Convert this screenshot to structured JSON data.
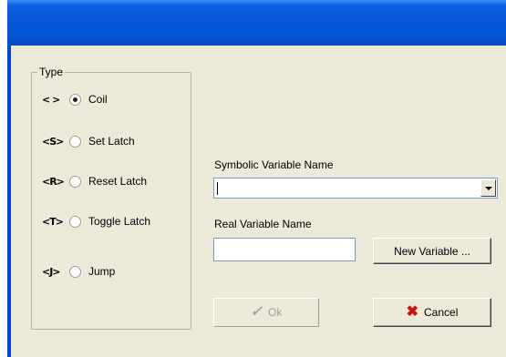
{
  "dialog": {
    "group_title": "Type",
    "types": [
      {
        "symbol": "<  >",
        "label": "Coil",
        "checked": true
      },
      {
        "symbol": "<S>",
        "label": "Set Latch",
        "checked": false
      },
      {
        "symbol": "<R>",
        "label": "Reset Latch",
        "checked": false
      },
      {
        "symbol": "<T>",
        "label": "Toggle Latch",
        "checked": false
      },
      {
        "symbol": "<J>",
        "label": "Jump",
        "checked": false
      }
    ],
    "symbolic_label": "Symbolic Variable Name",
    "symbolic_value": "",
    "real_label": "Real Variable Name",
    "real_value": "",
    "new_variable_label": "New Variable ...",
    "ok_label": "Ok",
    "cancel_label": "Cancel"
  },
  "icons": {
    "ok": "checkmark-icon",
    "cancel": "red-x-icon"
  }
}
